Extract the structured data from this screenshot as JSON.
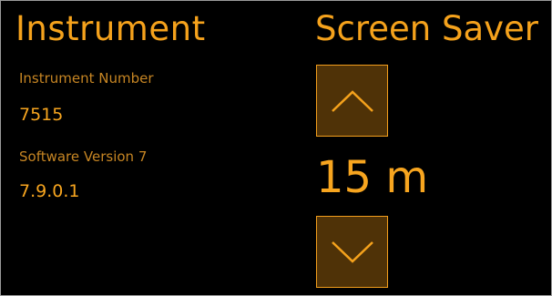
{
  "instrument": {
    "title": "Instrument",
    "number_label": "Instrument Number",
    "number_value": "7515",
    "software_label": "Software Version 7",
    "software_value": "7.9.0.1"
  },
  "screen_saver": {
    "title": "Screen Saver",
    "value": "15 m",
    "up_icon": "chevron-up-icon",
    "down_icon": "chevron-down-icon"
  },
  "colors": {
    "accent": "#f5a21c",
    "button_fill": "#4f3207",
    "background": "#000000"
  }
}
